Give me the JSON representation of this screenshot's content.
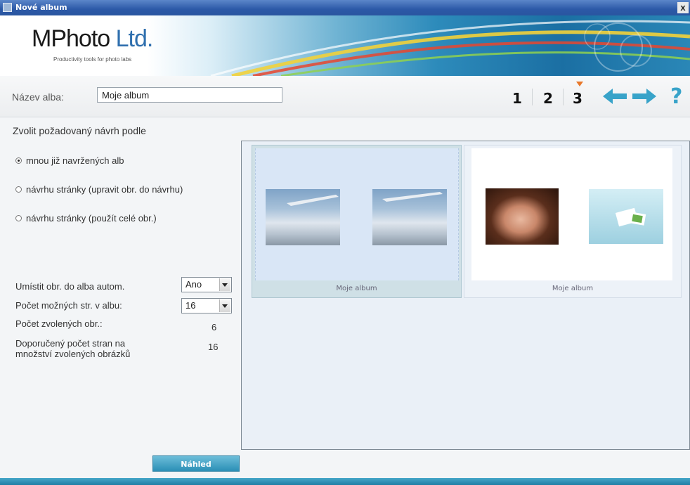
{
  "window": {
    "title": "Nové album",
    "close_glyph": "x"
  },
  "banner": {
    "logo_text_a": "MPhoto",
    "logo_text_b": "Ltd.",
    "tagline": "Productivity tools for photo labs"
  },
  "name_bar": {
    "label": "Název alba:",
    "value": "Moje album",
    "steps": [
      "1",
      "2",
      "3"
    ],
    "current_step": 3,
    "help": "?"
  },
  "left": {
    "section_title": "Zvolit požadovaný návrh podle",
    "options": [
      {
        "label": "mnou již navržených alb",
        "selected": true
      },
      {
        "label": "návrhu stránky (upravit obr. do návrhu)",
        "selected": false
      },
      {
        "label": "návrhu stránky (použít celé obr.)",
        "selected": false
      }
    ],
    "auto_place": {
      "label": "Umístit obr. do alba autom.",
      "value": "Ano"
    },
    "pages_possible": {
      "label": "Počet možných str. v albu:",
      "value": "16"
    },
    "selected_count": {
      "label": "Počet zvolených obr.:",
      "value": "6"
    },
    "recommended": {
      "label_line1": "Doporučený počet stran na",
      "label_line2": "množství zvolených obrázků",
      "value": "16"
    },
    "preview_button": "Náhled"
  },
  "gallery": {
    "cards": [
      {
        "caption": "Moje album"
      },
      {
        "caption": "Moje album"
      }
    ]
  },
  "colors": {
    "accent": "#2b8fb6",
    "step_marker": "#e8782a",
    "nav_arrow": "#38a3c9"
  }
}
